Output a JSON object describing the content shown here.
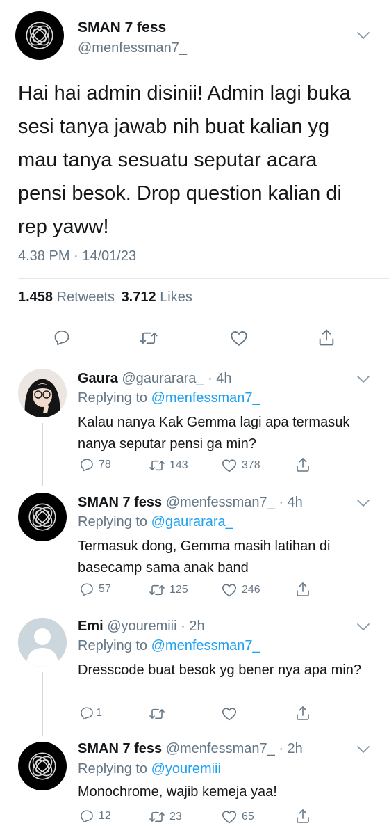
{
  "main_tweet": {
    "display_name": "SMAN 7 fess",
    "handle": "@menfessman7_",
    "text": "Hai hai admin disinii! Admin lagi buka sesi tanya jawab nih buat kalian yg mau tanya sesuatu seputar acara pensi besok. Drop question kalian di rep yaww!",
    "timestamp": "4.38 PM · 14/01/23",
    "retweets_count": "1.458",
    "retweets_label": "Retweets",
    "likes_count": "3.712",
    "likes_label": "Likes"
  },
  "replies": [
    {
      "display_name": "Gaura",
      "handle_time": "@gaurarara_ · 4h",
      "replying_prefix": "Replying to",
      "replying_to": "@menfessman7_",
      "text": "Kalau nanya Kak Gemma lagi apa termasuk nanya seputar pensi ga min?",
      "replies": "78",
      "retweets": "143",
      "likes": "378"
    },
    {
      "display_name": "SMAN 7 fess",
      "handle_time": "@menfessman7_ · 4h",
      "replying_prefix": "Replying to",
      "replying_to": "@gaurarara_",
      "text": "Termasuk dong, Gemma masih latihan di basecamp sama anak band",
      "replies": "57",
      "retweets": "125",
      "likes": "246"
    },
    {
      "display_name": "Emi",
      "handle_time": "@youremiii · 2h",
      "replying_prefix": "Replying to",
      "replying_to": "@menfessman7_",
      "text": "Dresscode buat besok yg bener nya apa min?",
      "replies": "1",
      "retweets": "",
      "likes": ""
    },
    {
      "display_name": "SMAN 7 fess",
      "handle_time": "@menfessman7_ · 2h",
      "replying_prefix": "Replying to",
      "replying_to": "@youremiii",
      "text": "Monochrome, wajib kemeja yaa!",
      "replies": "12",
      "retweets": "23",
      "likes": "65"
    }
  ],
  "icons": {
    "reply": "comment-icon",
    "retweet": "retweet-icon",
    "like": "heart-icon",
    "share": "share-icon",
    "more": "chevron-down-icon"
  },
  "colors": {
    "link": "#1da1f2",
    "muted": "#657786",
    "divider": "#e1e8ed"
  }
}
